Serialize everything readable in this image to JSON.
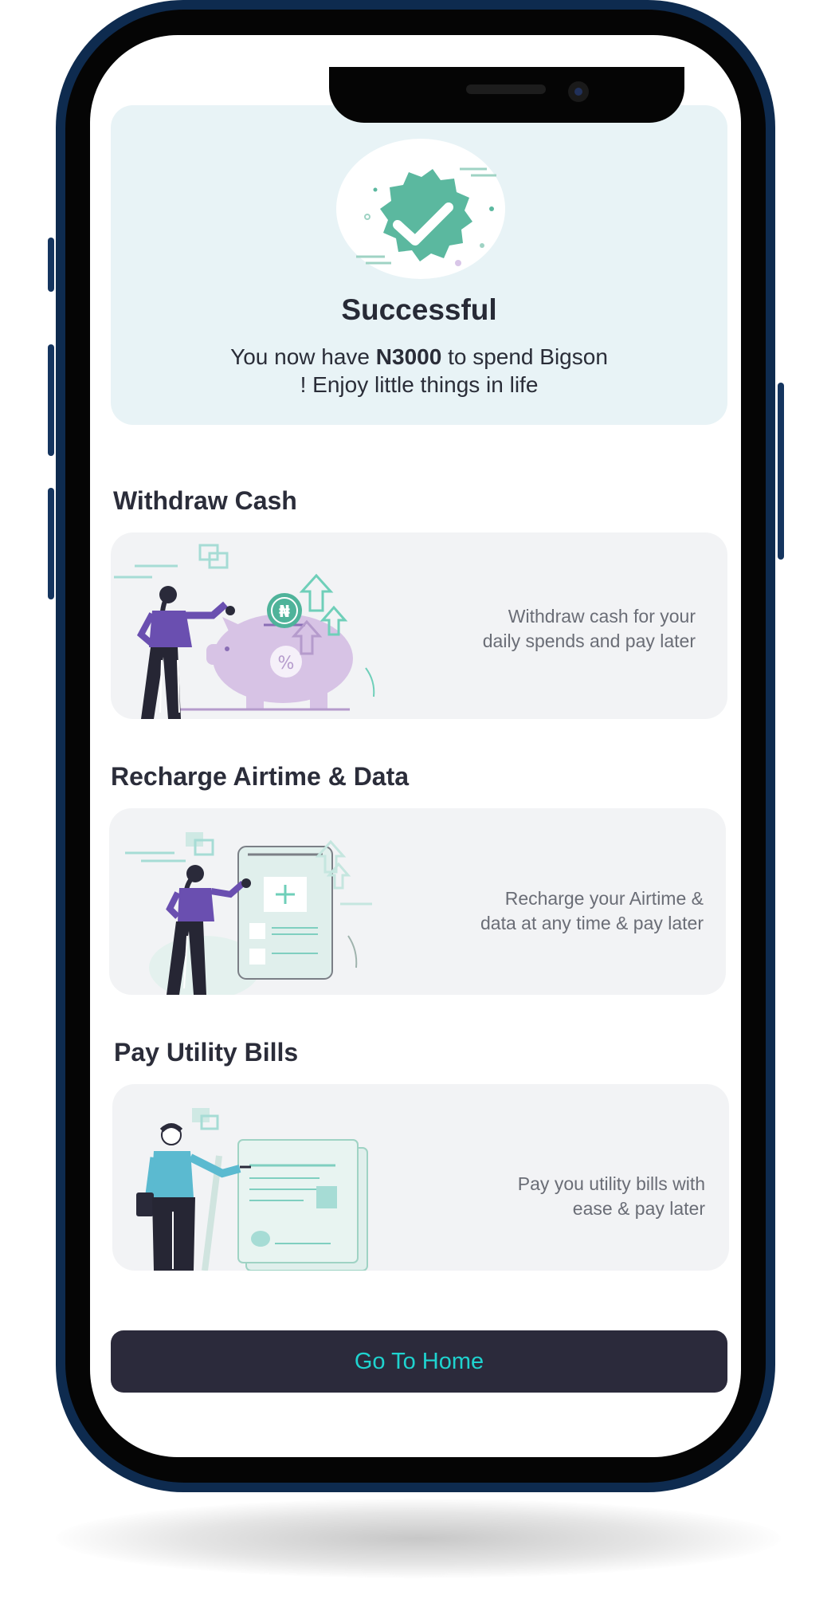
{
  "success": {
    "title": "Successful",
    "message_prefix": "You now have ",
    "amount": "N3000",
    "message_suffix": " to spend Bigson",
    "message_line2": "! Enjoy little things in life"
  },
  "sections": [
    {
      "title": "Withdraw Cash",
      "description_line1": "Withdraw cash for your",
      "description_line2": "daily spends and pay later",
      "coin_symbol": "₦",
      "piggy_symbol": "%"
    },
    {
      "title": "Recharge Airtime &  Data",
      "description_line1": "Recharge your Airtime &",
      "description_line2": "data at any time & pay later"
    },
    {
      "title": "Pay Utility Bills",
      "description_line1": "Pay you utility bills with",
      "description_line2": "ease & pay later"
    }
  ],
  "home_button": {
    "label": "Go To Home"
  },
  "colors": {
    "accent": "#1fd3cf",
    "button_bg": "#2b2a3b",
    "success_bg": "#e8f3f6",
    "badge_green": "#5bb89f",
    "purple": "#6a4fb0",
    "teal_shirt": "#5bbad0"
  },
  "icons": {
    "success": "check-badge-icon",
    "withdraw": "piggy-bank-illustration",
    "recharge": "phone-recharge-illustration",
    "bills": "utility-bill-illustration"
  }
}
